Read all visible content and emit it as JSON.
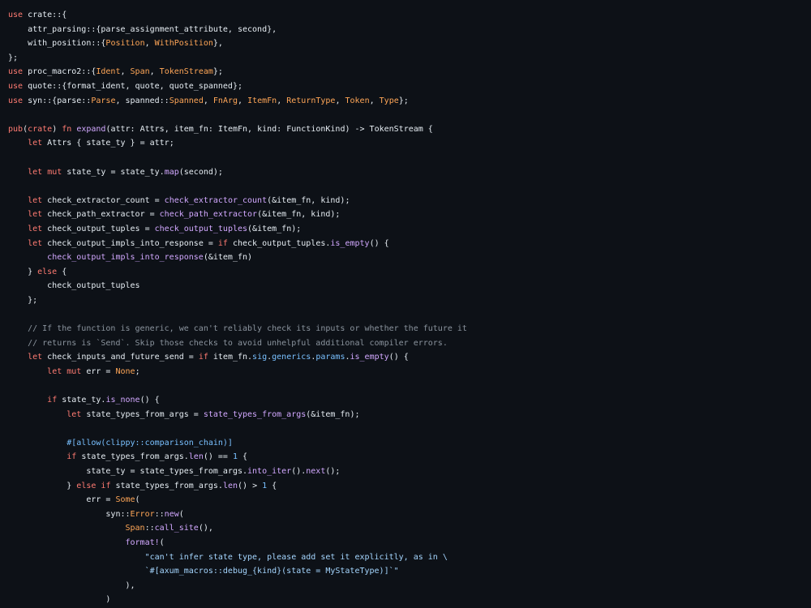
{
  "colors": {
    "background": "#0d1117",
    "text": "#e6edf3",
    "keyword": "#ff7b72",
    "function": "#d2a8ff",
    "type": "#ffa657",
    "string": "#a5d6ff",
    "number": "#79c0ff",
    "comment": "#8b949e"
  },
  "code_lines": [
    [
      {
        "t": "use",
        "c": "kw"
      },
      {
        "t": " crate::{",
        "c": "pl"
      }
    ],
    [
      {
        "t": "    attr_parsing::{parse_assignment_attribute, second},",
        "c": "pl"
      }
    ],
    [
      {
        "t": "    with_position::{",
        "c": "pl"
      },
      {
        "t": "Position",
        "c": "ty"
      },
      {
        "t": ", ",
        "c": "pl"
      },
      {
        "t": "WithPosition",
        "c": "ty"
      },
      {
        "t": "},",
        "c": "pl"
      }
    ],
    [
      {
        "t": "};",
        "c": "pl"
      }
    ],
    [
      {
        "t": "use",
        "c": "kw"
      },
      {
        "t": " proc_macro2::{",
        "c": "pl"
      },
      {
        "t": "Ident",
        "c": "ty"
      },
      {
        "t": ", ",
        "c": "pl"
      },
      {
        "t": "Span",
        "c": "ty"
      },
      {
        "t": ", ",
        "c": "pl"
      },
      {
        "t": "TokenStream",
        "c": "ty"
      },
      {
        "t": "};",
        "c": "pl"
      }
    ],
    [
      {
        "t": "use",
        "c": "kw"
      },
      {
        "t": " quote::{format_ident, quote, quote_spanned};",
        "c": "pl"
      }
    ],
    [
      {
        "t": "use",
        "c": "kw"
      },
      {
        "t": " syn::{parse::",
        "c": "pl"
      },
      {
        "t": "Parse",
        "c": "ty"
      },
      {
        "t": ", spanned::",
        "c": "pl"
      },
      {
        "t": "Spanned",
        "c": "ty"
      },
      {
        "t": ", ",
        "c": "pl"
      },
      {
        "t": "FnArg",
        "c": "ty"
      },
      {
        "t": ", ",
        "c": "pl"
      },
      {
        "t": "ItemFn",
        "c": "ty"
      },
      {
        "t": ", ",
        "c": "pl"
      },
      {
        "t": "ReturnType",
        "c": "ty"
      },
      {
        "t": ", ",
        "c": "pl"
      },
      {
        "t": "Token",
        "c": "ty"
      },
      {
        "t": ", ",
        "c": "pl"
      },
      {
        "t": "Type",
        "c": "ty"
      },
      {
        "t": "};",
        "c": "pl"
      }
    ],
    [],
    [
      {
        "t": "pub",
        "c": "kw"
      },
      {
        "t": "(",
        "c": "pl"
      },
      {
        "t": "crate",
        "c": "kw"
      },
      {
        "t": ") ",
        "c": "pl"
      },
      {
        "t": "fn",
        "c": "kw"
      },
      {
        "t": " ",
        "c": "pl"
      },
      {
        "t": "expand",
        "c": "fn"
      },
      {
        "t": "(attr: Attrs, item_fn: ItemFn, kind: FunctionKind) -> TokenStream {",
        "c": "pl"
      }
    ],
    [
      {
        "t": "    ",
        "c": "pl"
      },
      {
        "t": "let",
        "c": "kw"
      },
      {
        "t": " Attrs { state_ty } = attr;",
        "c": "pl"
      }
    ],
    [],
    [
      {
        "t": "    ",
        "c": "pl"
      },
      {
        "t": "let",
        "c": "kw"
      },
      {
        "t": " ",
        "c": "pl"
      },
      {
        "t": "mut",
        "c": "kw"
      },
      {
        "t": " state_ty = state_ty.",
        "c": "pl"
      },
      {
        "t": "map",
        "c": "fn"
      },
      {
        "t": "(second);",
        "c": "pl"
      }
    ],
    [],
    [
      {
        "t": "    ",
        "c": "pl"
      },
      {
        "t": "let",
        "c": "kw"
      },
      {
        "t": " check_extractor_count = ",
        "c": "pl"
      },
      {
        "t": "check_extractor_count",
        "c": "fn"
      },
      {
        "t": "(&item_fn, kind);",
        "c": "pl"
      }
    ],
    [
      {
        "t": "    ",
        "c": "pl"
      },
      {
        "t": "let",
        "c": "kw"
      },
      {
        "t": " check_path_extractor = ",
        "c": "pl"
      },
      {
        "t": "check_path_extractor",
        "c": "fn"
      },
      {
        "t": "(&item_fn, kind);",
        "c": "pl"
      }
    ],
    [
      {
        "t": "    ",
        "c": "pl"
      },
      {
        "t": "let",
        "c": "kw"
      },
      {
        "t": " check_output_tuples = ",
        "c": "pl"
      },
      {
        "t": "check_output_tuples",
        "c": "fn"
      },
      {
        "t": "(&item_fn);",
        "c": "pl"
      }
    ],
    [
      {
        "t": "    ",
        "c": "pl"
      },
      {
        "t": "let",
        "c": "kw"
      },
      {
        "t": " check_output_impls_into_response = ",
        "c": "pl"
      },
      {
        "t": "if",
        "c": "kw"
      },
      {
        "t": " check_output_tuples.",
        "c": "pl"
      },
      {
        "t": "is_empty",
        "c": "fn"
      },
      {
        "t": "() {",
        "c": "pl"
      }
    ],
    [
      {
        "t": "        ",
        "c": "pl"
      },
      {
        "t": "check_output_impls_into_response",
        "c": "fn"
      },
      {
        "t": "(&item_fn)",
        "c": "pl"
      }
    ],
    [
      {
        "t": "    } ",
        "c": "pl"
      },
      {
        "t": "else",
        "c": "kw"
      },
      {
        "t": " {",
        "c": "pl"
      }
    ],
    [
      {
        "t": "        check_output_tuples",
        "c": "pl"
      }
    ],
    [
      {
        "t": "    };",
        "c": "pl"
      }
    ],
    [],
    [
      {
        "t": "    // If the function is generic, we can't reliably check its inputs or whether the future it",
        "c": "cm"
      }
    ],
    [
      {
        "t": "    // returns is `Send`. Skip those checks to avoid unhelpful additional compiler errors.",
        "c": "cm"
      }
    ],
    [
      {
        "t": "    ",
        "c": "pl"
      },
      {
        "t": "let",
        "c": "kw"
      },
      {
        "t": " check_inputs_and_future_send = ",
        "c": "pl"
      },
      {
        "t": "if",
        "c": "kw"
      },
      {
        "t": " item_fn.",
        "c": "pl"
      },
      {
        "t": "sig",
        "c": "num"
      },
      {
        "t": ".",
        "c": "pl"
      },
      {
        "t": "generics",
        "c": "num"
      },
      {
        "t": ".",
        "c": "pl"
      },
      {
        "t": "params",
        "c": "num"
      },
      {
        "t": ".",
        "c": "pl"
      },
      {
        "t": "is_empty",
        "c": "fn"
      },
      {
        "t": "() {",
        "c": "pl"
      }
    ],
    [
      {
        "t": "        ",
        "c": "pl"
      },
      {
        "t": "let",
        "c": "kw"
      },
      {
        "t": " ",
        "c": "pl"
      },
      {
        "t": "mut",
        "c": "kw"
      },
      {
        "t": " err = ",
        "c": "pl"
      },
      {
        "t": "None",
        "c": "ty"
      },
      {
        "t": ";",
        "c": "pl"
      }
    ],
    [],
    [
      {
        "t": "        ",
        "c": "pl"
      },
      {
        "t": "if",
        "c": "kw"
      },
      {
        "t": " state_ty.",
        "c": "pl"
      },
      {
        "t": "is_none",
        "c": "fn"
      },
      {
        "t": "() {",
        "c": "pl"
      }
    ],
    [
      {
        "t": "            ",
        "c": "pl"
      },
      {
        "t": "let",
        "c": "kw"
      },
      {
        "t": " state_types_from_args = ",
        "c": "pl"
      },
      {
        "t": "state_types_from_args",
        "c": "fn"
      },
      {
        "t": "(&item_fn);",
        "c": "pl"
      }
    ],
    [],
    [
      {
        "t": "            ",
        "c": "pl"
      },
      {
        "t": "#[allow(clippy::comparison_chain)]",
        "c": "num"
      }
    ],
    [
      {
        "t": "            ",
        "c": "pl"
      },
      {
        "t": "if",
        "c": "kw"
      },
      {
        "t": " state_types_from_args.",
        "c": "pl"
      },
      {
        "t": "len",
        "c": "fn"
      },
      {
        "t": "() == ",
        "c": "pl"
      },
      {
        "t": "1",
        "c": "num"
      },
      {
        "t": " {",
        "c": "pl"
      }
    ],
    [
      {
        "t": "                state_ty = state_types_from_args.",
        "c": "pl"
      },
      {
        "t": "into_iter",
        "c": "fn"
      },
      {
        "t": "().",
        "c": "pl"
      },
      {
        "t": "next",
        "c": "fn"
      },
      {
        "t": "();",
        "c": "pl"
      }
    ],
    [
      {
        "t": "            } ",
        "c": "pl"
      },
      {
        "t": "else",
        "c": "kw"
      },
      {
        "t": " ",
        "c": "pl"
      },
      {
        "t": "if",
        "c": "kw"
      },
      {
        "t": " state_types_from_args.",
        "c": "pl"
      },
      {
        "t": "len",
        "c": "fn"
      },
      {
        "t": "() > ",
        "c": "pl"
      },
      {
        "t": "1",
        "c": "num"
      },
      {
        "t": " {",
        "c": "pl"
      }
    ],
    [
      {
        "t": "                err = ",
        "c": "pl"
      },
      {
        "t": "Some",
        "c": "ty"
      },
      {
        "t": "(",
        "c": "pl"
      }
    ],
    [
      {
        "t": "                    syn::",
        "c": "pl"
      },
      {
        "t": "Error",
        "c": "ty"
      },
      {
        "t": "::",
        "c": "pl"
      },
      {
        "t": "new",
        "c": "fn"
      },
      {
        "t": "(",
        "c": "pl"
      }
    ],
    [
      {
        "t": "                        ",
        "c": "pl"
      },
      {
        "t": "Span",
        "c": "ty"
      },
      {
        "t": "::",
        "c": "pl"
      },
      {
        "t": "call_site",
        "c": "fn"
      },
      {
        "t": "(),",
        "c": "pl"
      }
    ],
    [
      {
        "t": "                        ",
        "c": "pl"
      },
      {
        "t": "format!",
        "c": "mac"
      },
      {
        "t": "(",
        "c": "pl"
      }
    ],
    [
      {
        "t": "                            \"can't infer state type, please add set it explicitly, as in \\",
        "c": "str"
      }
    ],
    [
      {
        "t": "                            `#[axum_macros::debug_{kind}(state = MyStateType)]`\"",
        "c": "str"
      }
    ],
    [
      {
        "t": "                        ),",
        "c": "pl"
      }
    ],
    [
      {
        "t": "                    )",
        "c": "pl"
      }
    ]
  ]
}
